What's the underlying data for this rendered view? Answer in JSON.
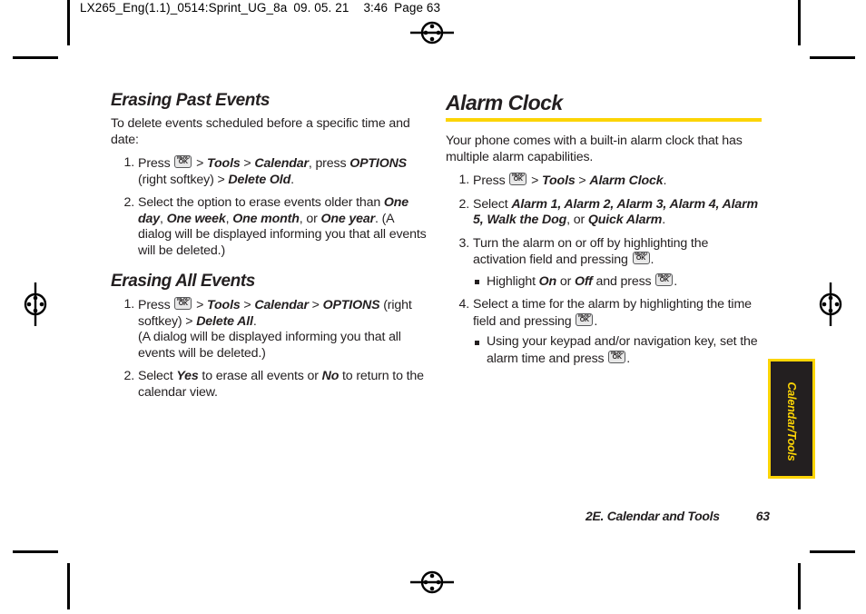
{
  "header": {
    "slug_file": "LX265_Eng(1.1)_0514:Sprint_UG_8a",
    "slug_date": "09. 05. 21",
    "slug_time": "3:46",
    "slug_page": "Page 63"
  },
  "colors": {
    "accent_yellow": "#FCD405",
    "tab_background": "#231f20",
    "text": "#231f20"
  },
  "key_glyph": {
    "top_label": "MENU",
    "bottom_label": "OK"
  },
  "left_column": {
    "section1": {
      "heading": "Erasing Past Events",
      "intro": "To delete events scheduled before a specific time and date:",
      "steps": [
        {
          "num": "1.",
          "parts": [
            {
              "t": "Press ",
              "s": "plain"
            },
            {
              "t": "KEY",
              "s": "key"
            },
            {
              "t": " > ",
              "s": "plain"
            },
            {
              "t": "Tools",
              "s": "bolditalic"
            },
            {
              "t": " > ",
              "s": "plain"
            },
            {
              "t": "Calendar",
              "s": "bolditalic"
            },
            {
              "t": ", press ",
              "s": "plain"
            },
            {
              "t": "OPTIONS",
              "s": "bolditalic"
            },
            {
              "t": " (right softkey)",
              "s": "plain"
            },
            {
              "t": " > ",
              "s": "plain"
            },
            {
              "t": "Delete Old",
              "s": "bolditalic"
            },
            {
              "t": ".",
              "s": "plain"
            }
          ]
        },
        {
          "num": "2.",
          "parts": [
            {
              "t": "Select the option to erase events older than ",
              "s": "plain"
            },
            {
              "t": "One day",
              "s": "bolditalic"
            },
            {
              "t": ", ",
              "s": "plain"
            },
            {
              "t": "One week",
              "s": "bolditalic"
            },
            {
              "t": ", ",
              "s": "plain"
            },
            {
              "t": "One month",
              "s": "bolditalic"
            },
            {
              "t": ", or ",
              "s": "plain"
            },
            {
              "t": "One year",
              "s": "bolditalic"
            },
            {
              "t": ". (A dialog will be displayed informing you that all events will be deleted.)",
              "s": "plain"
            }
          ]
        }
      ]
    },
    "section2": {
      "heading": "Erasing All Events",
      "steps": [
        {
          "num": "1.",
          "parts": [
            {
              "t": "Press ",
              "s": "plain"
            },
            {
              "t": "KEY",
              "s": "key"
            },
            {
              "t": " > ",
              "s": "plain"
            },
            {
              "t": "Tools",
              "s": "bolditalic"
            },
            {
              "t": " > ",
              "s": "plain"
            },
            {
              "t": "Calendar",
              "s": "bolditalic"
            },
            {
              "t": " > ",
              "s": "plain"
            },
            {
              "t": "OPTIONS",
              "s": "bolditalic"
            },
            {
              "t": " (right softkey) > ",
              "s": "plain"
            },
            {
              "t": "Delete All",
              "s": "bolditalic"
            },
            {
              "t": ".",
              "s": "plain"
            },
            {
              "t": "BR",
              "s": "break"
            },
            {
              "t": "(A dialog will be displayed informing you that all events will be deleted.)",
              "s": "plain"
            }
          ]
        },
        {
          "num": "2.",
          "parts": [
            {
              "t": "Select ",
              "s": "plain"
            },
            {
              "t": "Yes",
              "s": "bolditalic"
            },
            {
              "t": " to erase all events or ",
              "s": "plain"
            },
            {
              "t": "No",
              "s": "bolditalic"
            },
            {
              "t": " to return to the calendar view.",
              "s": "plain"
            }
          ]
        }
      ]
    }
  },
  "right_column": {
    "heading": "Alarm Clock",
    "intro": "Your phone comes with a built-in alarm clock that has multiple alarm capabilities.",
    "steps": [
      {
        "num": "1.",
        "parts": [
          {
            "t": "Press ",
            "s": "plain"
          },
          {
            "t": "KEY",
            "s": "key"
          },
          {
            "t": " > ",
            "s": "plain"
          },
          {
            "t": "Tools",
            "s": "bolditalic"
          },
          {
            "t": " > ",
            "s": "plain"
          },
          {
            "t": "Alarm Clock",
            "s": "bolditalic"
          },
          {
            "t": ".",
            "s": "plain"
          }
        ],
        "subs": []
      },
      {
        "num": "2.",
        "parts": [
          {
            "t": "Select ",
            "s": "plain"
          },
          {
            "t": "Alarm 1, Alarm 2, Alarm 3, Alarm 4, Alarm 5, Walk the Dog",
            "s": "bolditalic"
          },
          {
            "t": ", or ",
            "s": "plain"
          },
          {
            "t": "Quick Alarm",
            "s": "bolditalic"
          },
          {
            "t": ".",
            "s": "plain"
          }
        ],
        "subs": []
      },
      {
        "num": "3.",
        "parts": [
          {
            "t": "Turn the alarm on or off by highlighting the activation field and pressing ",
            "s": "plain"
          },
          {
            "t": "KEY",
            "s": "key"
          },
          {
            "t": ".",
            "s": "plain"
          }
        ],
        "subs": [
          [
            {
              "t": "Highlight ",
              "s": "plain"
            },
            {
              "t": "On",
              "s": "bolditalic"
            },
            {
              "t": " or ",
              "s": "plain"
            },
            {
              "t": "Off",
              "s": "bolditalic"
            },
            {
              "t": " and press ",
              "s": "plain"
            },
            {
              "t": "KEY",
              "s": "key"
            },
            {
              "t": ".",
              "s": "plain"
            }
          ]
        ]
      },
      {
        "num": "4.",
        "parts": [
          {
            "t": "Select a time for the alarm by highlighting the time field and pressing ",
            "s": "plain"
          },
          {
            "t": "KEY",
            "s": "key"
          },
          {
            "t": ".",
            "s": "plain"
          }
        ],
        "subs": [
          [
            {
              "t": "Using your keypad and/or navigation key, set the alarm time and press ",
              "s": "plain"
            },
            {
              "t": "KEY",
              "s": "key"
            },
            {
              "t": ".",
              "s": "plain"
            }
          ]
        ]
      }
    ]
  },
  "side_tab": {
    "label": "Calendar/Tools"
  },
  "footer": {
    "chapter": "2E. Calendar and Tools",
    "page_number": "63"
  }
}
